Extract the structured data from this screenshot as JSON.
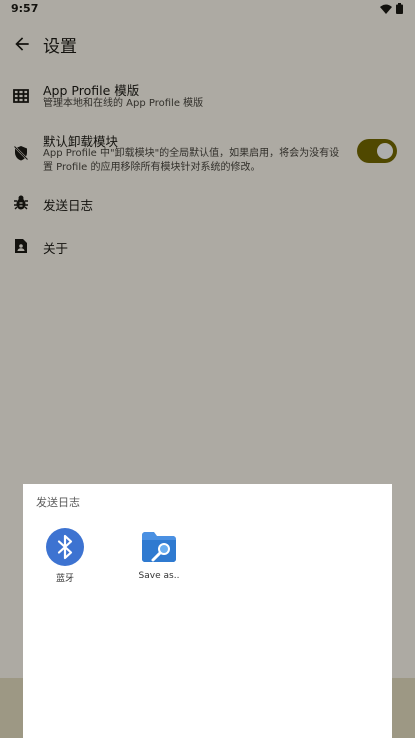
{
  "status_bar": {
    "time": "9:57"
  },
  "app_bar": {
    "title": "设置",
    "back_icon": "back-arrow-icon"
  },
  "settings": [
    {
      "title": "App Profile 模版",
      "subtitle": "管理本地和在线的 App Profile 模版",
      "icon": "grid-icon"
    },
    {
      "title": "默认卸载模块",
      "subtitle": "App Profile 中\"卸载模块\"的全局默认值，如果启用，将会为没有设置 Profile 的应用移除所有模块针对系统的修改。",
      "icon": "shield-off-icon",
      "switch_on": true
    },
    {
      "title": "发送日志",
      "icon": "bug-icon"
    },
    {
      "title": "关于",
      "icon": "contact-page-icon"
    }
  ],
  "share_sheet": {
    "title": "发送日志",
    "targets": [
      {
        "label": "蓝牙",
        "icon": "bluetooth-icon"
      },
      {
        "label": "Save as..",
        "icon": "folder-search-icon"
      }
    ]
  },
  "colors": {
    "accent": "#776a00",
    "background": "#fffbf0",
    "bluetooth": "#3d73d1",
    "folder": "#4a90e2"
  }
}
